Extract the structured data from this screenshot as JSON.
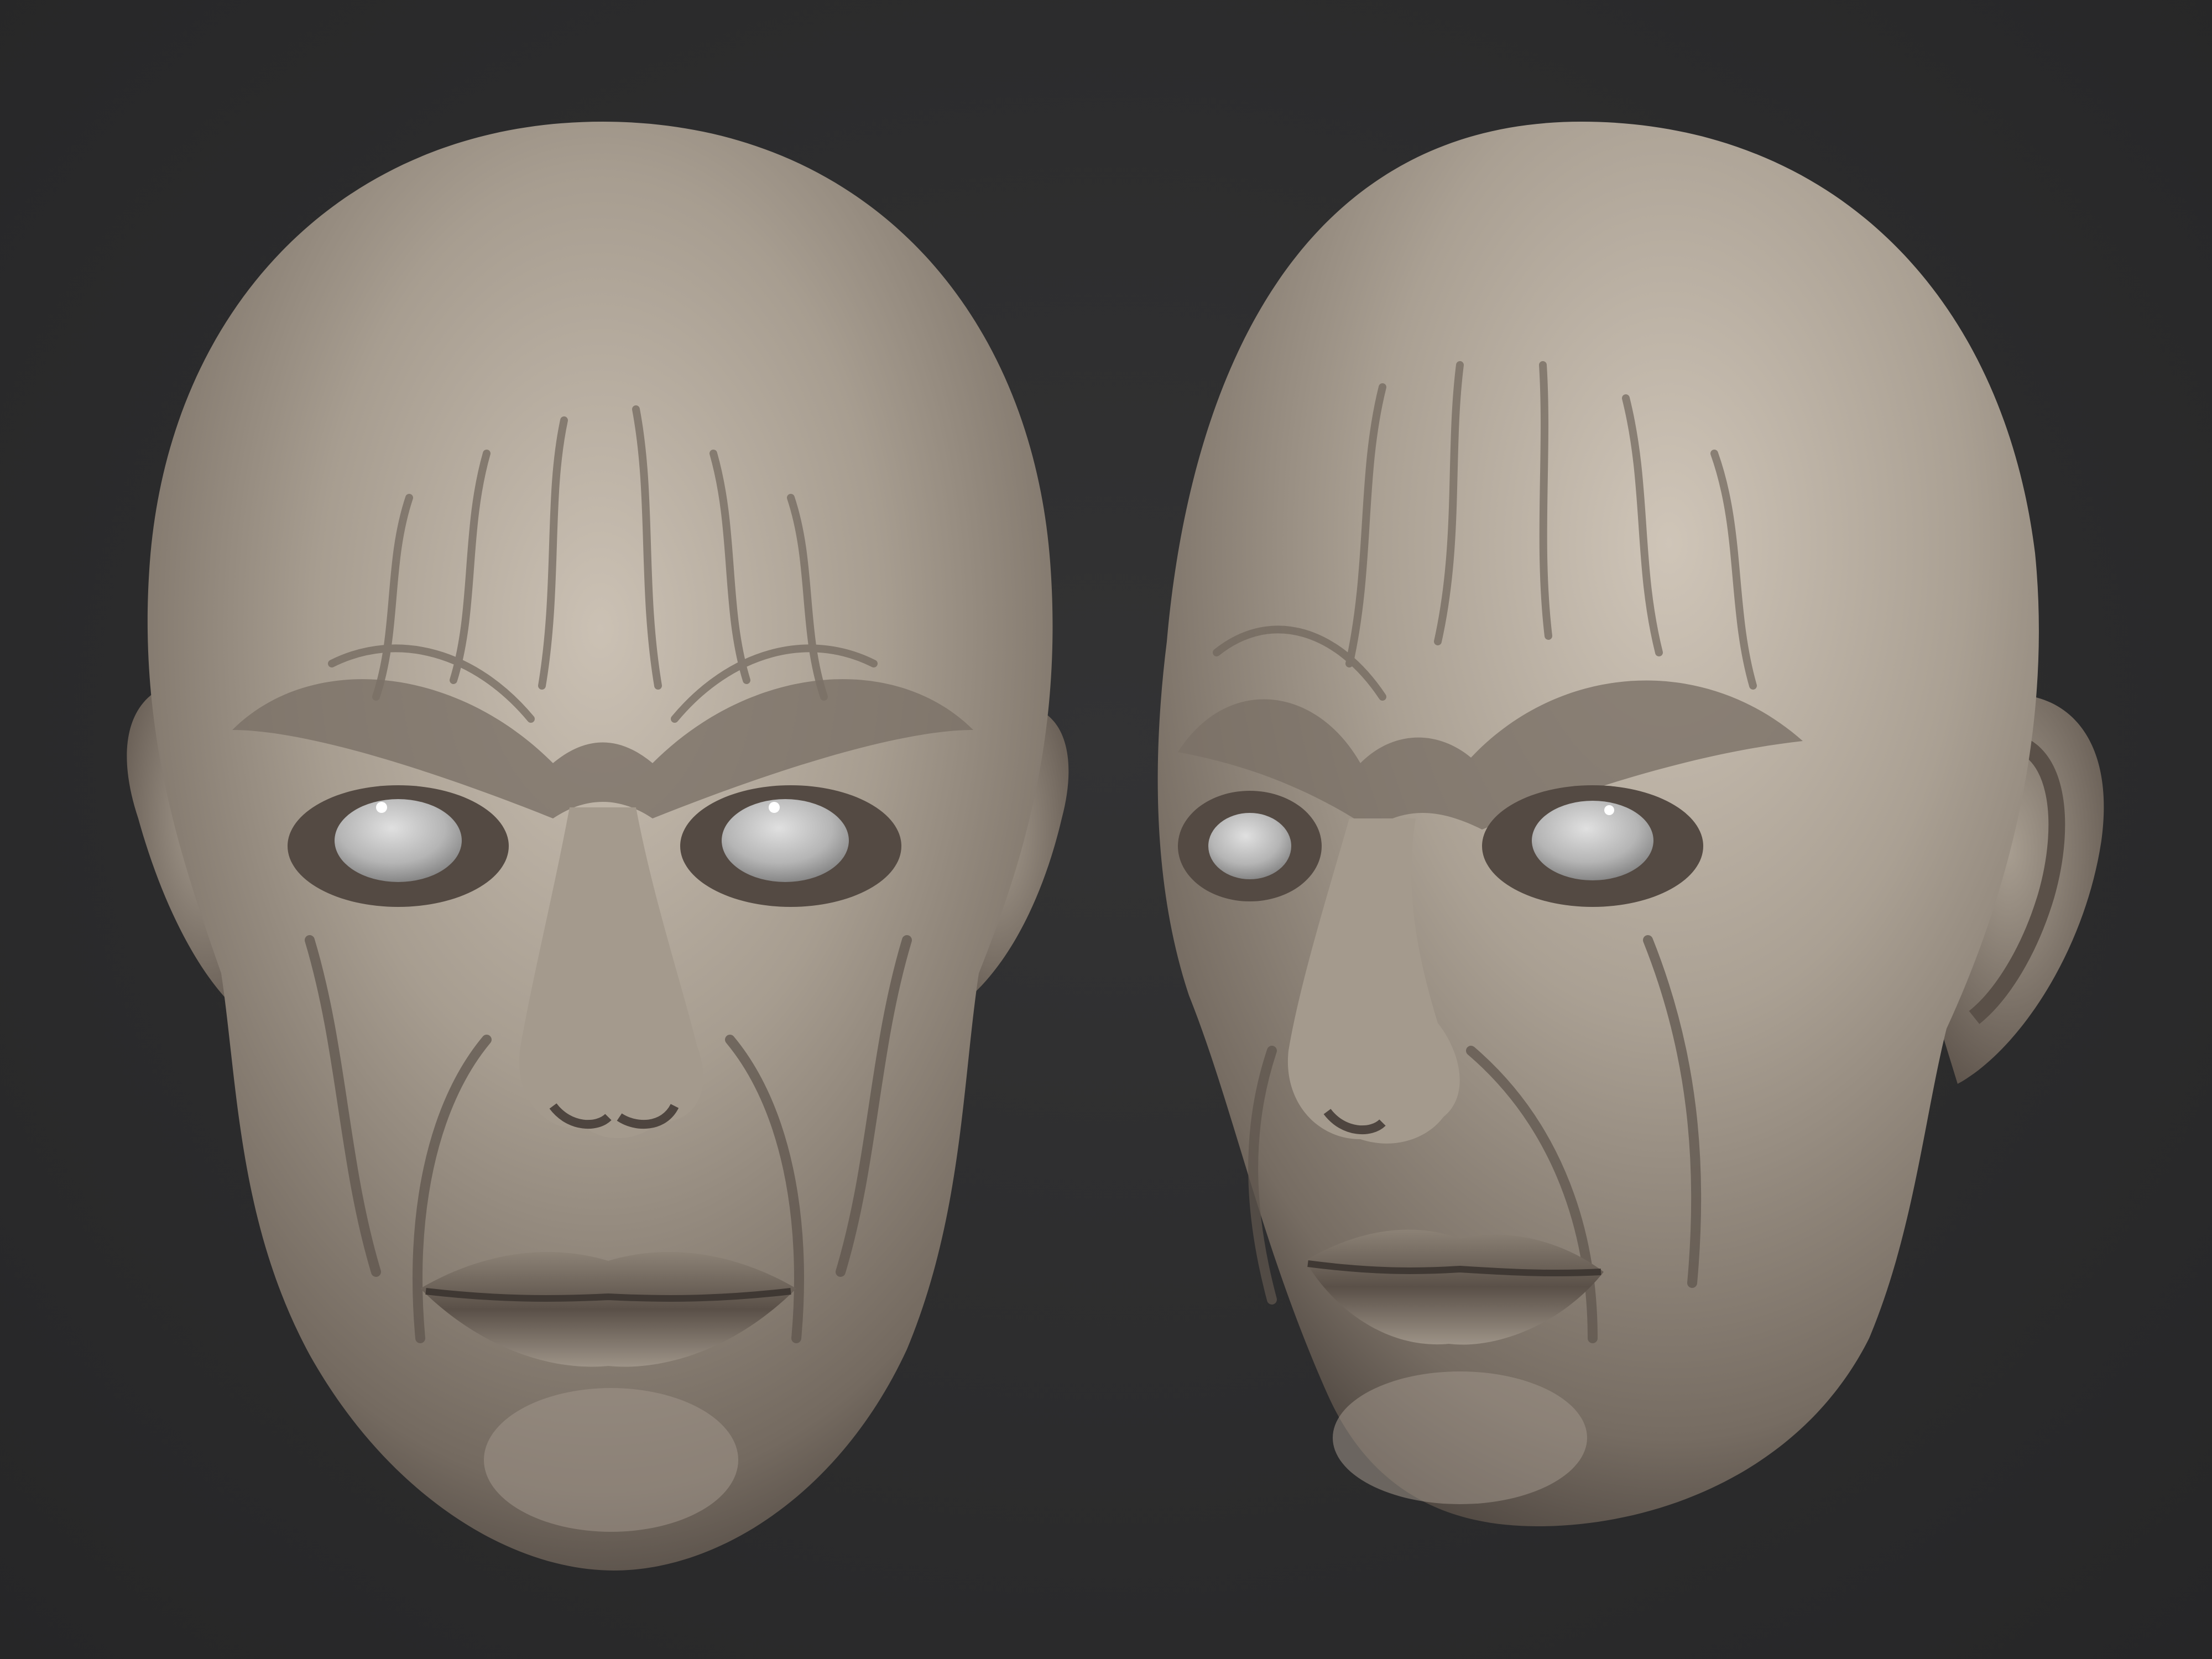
{
  "scene": {
    "background_color": "#2b2b2c",
    "clay_color": "#a0968a",
    "clay_highlight": "#c9bfb2",
    "clay_shadow": "#5e544c",
    "eye_color": "#b9b9b9",
    "views": [
      "front",
      "three-quarter"
    ]
  }
}
